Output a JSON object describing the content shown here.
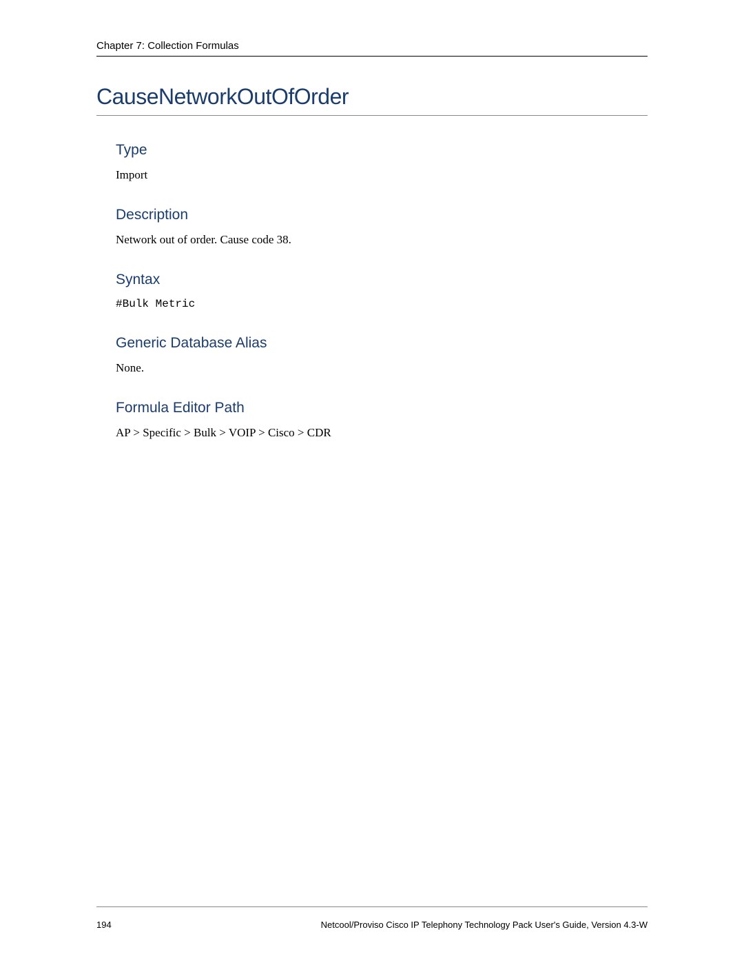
{
  "header": {
    "chapter": "Chapter 7: Collection Formulas"
  },
  "title": "CauseNetworkOutOfOrder",
  "sections": {
    "type": {
      "heading": "Type",
      "body": "Import"
    },
    "description": {
      "heading": "Description",
      "body": "Network out of order. Cause code 38."
    },
    "syntax": {
      "heading": "Syntax",
      "body": "#Bulk Metric"
    },
    "alias": {
      "heading": "Generic Database Alias",
      "body": "None."
    },
    "path": {
      "heading": "Formula Editor Path",
      "body": "AP > Specific > Bulk > VOIP > Cisco > CDR"
    }
  },
  "footer": {
    "page": "194",
    "guide": "Netcool/Proviso Cisco IP Telephony Technology Pack User's Guide, Version 4.3-W"
  }
}
